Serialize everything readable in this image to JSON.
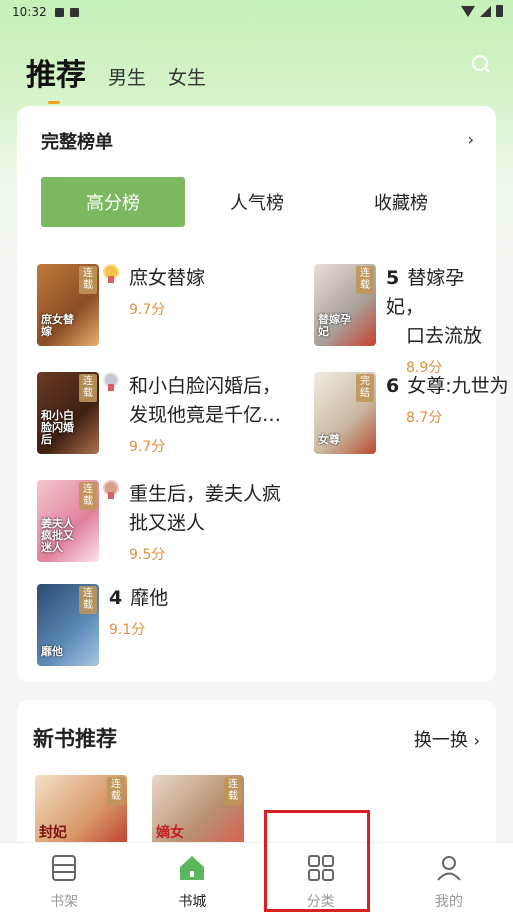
{
  "status_bar": {
    "time": "10:32"
  },
  "header": {
    "tabs": [
      {
        "label": "推荐",
        "active": true
      },
      {
        "label": "男生",
        "active": false
      },
      {
        "label": "女生",
        "active": false
      }
    ]
  },
  "ranking": {
    "title": "完整榜单",
    "more": "›",
    "tabs": [
      {
        "label": "高分榜",
        "active": true
      },
      {
        "label": "人气榜",
        "active": false
      },
      {
        "label": "收藏榜",
        "active": false
      }
    ],
    "books": [
      {
        "rank": "1",
        "title": "庶女替嫁",
        "score": "9.7分",
        "tag": "连载",
        "cover_text": "庶女替嫁",
        "medal": "gold"
      },
      {
        "rank": "2",
        "title": "和小白脸闪婚后，",
        "title2": "发现他竟是千亿…",
        "score": "9.7分",
        "tag": "连载",
        "cover_text": "和小白脸闪婚后",
        "medal": "silver"
      },
      {
        "rank": "3",
        "title": "重生后，姜夫人疯",
        "title2": "批又迷人",
        "score": "9.5分",
        "tag": "连载",
        "cover_text": "姜夫人疯批又迷人",
        "medal": "bronze"
      },
      {
        "rank": "4",
        "title": "靡他",
        "score": "9.1分",
        "tag": "连载",
        "cover_text": "靡他"
      },
      {
        "rank": "5",
        "title": "替嫁孕妃，",
        "title2": "口去流放",
        "score": "8.9分",
        "tag": "连载",
        "cover_text": "替嫁孕妃"
      },
      {
        "rank": "6",
        "title": "女尊:九世为",
        "score": "8.7分",
        "tag": "完结",
        "cover_text": "女尊"
      }
    ]
  },
  "new_books": {
    "title": "新书推荐",
    "refresh": "换一换",
    "books": [
      {
        "tag": "连载",
        "cover_text": "封妃"
      },
      {
        "tag": "连载",
        "cover_text": "嫡女"
      }
    ]
  },
  "bottom_nav": [
    {
      "label": "书架",
      "icon": "bookshelf-icon",
      "active": false
    },
    {
      "label": "书城",
      "icon": "bookstore-icon",
      "active": true
    },
    {
      "label": "分类",
      "icon": "category-icon",
      "active": false
    },
    {
      "label": "我的",
      "icon": "profile-icon",
      "active": false
    }
  ],
  "colors": {
    "accent": "#7cb85f",
    "score": "#e09040",
    "header_bg": "#c5f0b8",
    "highlight": "#d82020"
  }
}
